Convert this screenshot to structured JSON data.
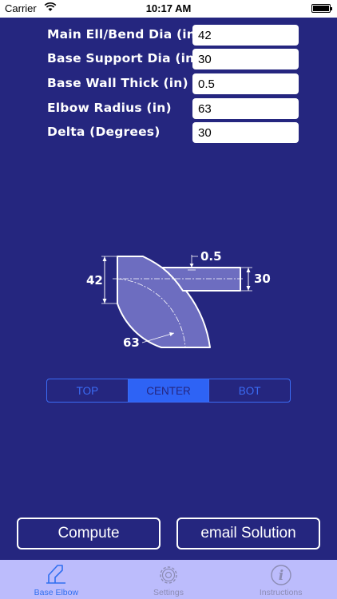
{
  "status_bar": {
    "carrier": "Carrier",
    "time": "10:17 AM"
  },
  "fields": [
    {
      "label": "Main Ell/Bend Dia (in)",
      "value": "42"
    },
    {
      "label": "Base Support Dia (in)",
      "value": "30"
    },
    {
      "label": "Base Wall Thick (in)",
      "value": "0.5"
    },
    {
      "label": "Elbow Radius (in)",
      "value": "63"
    },
    {
      "label": "Delta (Degrees)",
      "value": "30"
    }
  ],
  "diagram": {
    "main_dia": "42",
    "support_dia": "30",
    "wall_thick": "0.5",
    "radius": "63"
  },
  "segments": [
    {
      "label": "TOP",
      "selected": false
    },
    {
      "label": "CENTER",
      "selected": true
    },
    {
      "label": "BOT",
      "selected": false
    }
  ],
  "buttons": {
    "compute": "Compute",
    "email": "email Solution"
  },
  "tabs": [
    {
      "label": "Base Elbow",
      "icon": "base-elbow-icon",
      "active": true
    },
    {
      "label": "Settings",
      "icon": "gear-icon",
      "active": false
    },
    {
      "label": "Instructions",
      "icon": "info-icon",
      "active": false
    }
  ],
  "colors": {
    "background": "#25267f",
    "accent": "#2e63f5",
    "tab_bar": "#bcbcfc",
    "diagram_fill": "#6d6dc0"
  }
}
